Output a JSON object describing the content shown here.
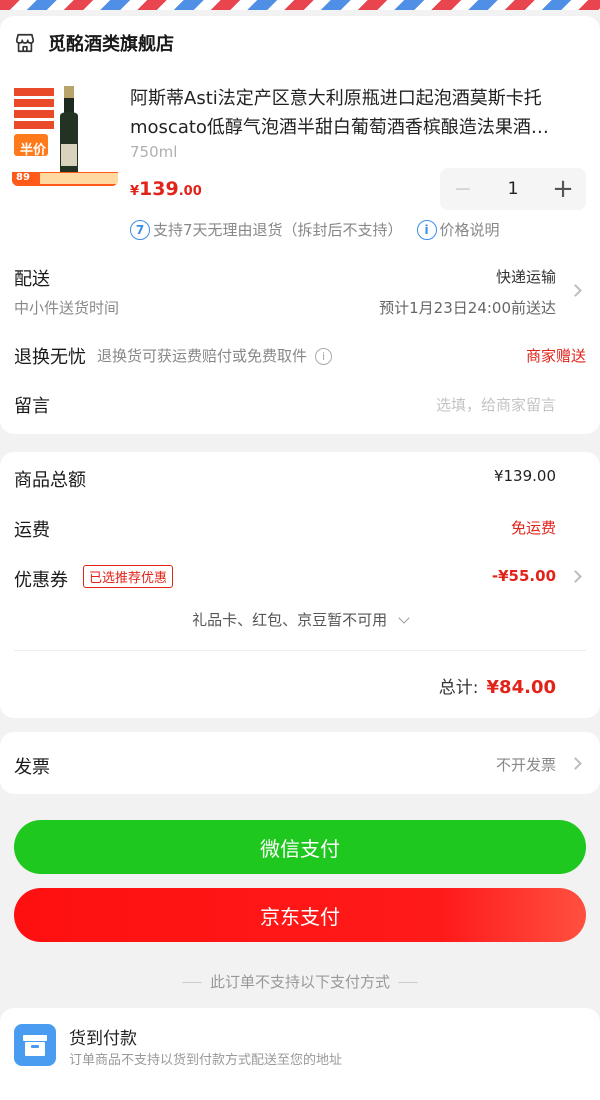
{
  "store": {
    "name": "觅酩酒类旗舰店"
  },
  "product": {
    "title": "阿斯蒂Asti法定产区意大利原瓶进口起泡酒莫斯卡托moscato低醇气泡酒半甜白葡萄酒香槟酿造法果酒…",
    "volume": "750ml",
    "price_currency": "¥",
    "price_int": "139",
    "price_dec": ".00",
    "quantity": "1",
    "image_badge": "半价",
    "image_price": "89"
  },
  "policy": {
    "badge": "7",
    "return_text": "支持7天无理由退货（拆封后不支持）",
    "price_note": "价格说明"
  },
  "delivery": {
    "label": "配送",
    "method": "快递运输",
    "sub": "中小件送货时间",
    "eta": "预计1月23日24:00前送达"
  },
  "worry_free": {
    "label": "退换无忧",
    "desc": "退换货可获运费赔付或免费取件",
    "status": "商家赠送"
  },
  "message": {
    "label": "留言",
    "placeholder": "选填，给商家留言"
  },
  "summary": {
    "goods_label": "商品总额",
    "goods_value": "¥139.00",
    "shipping_label": "运费",
    "shipping_value": "免运费",
    "coupon_label": "优惠券",
    "coupon_tag": "已选推荐优惠",
    "coupon_value": "-¥55.00",
    "unavailable": "礼品卡、红包、京豆暂不可用",
    "total_label": "总计:",
    "total_value": "¥84.00"
  },
  "invoice": {
    "label": "发票",
    "value": "不开发票"
  },
  "payment": {
    "wechat": "微信支付",
    "jd": "京东支付",
    "unsupported_note": "此订单不支持以下支付方式"
  },
  "cod": {
    "title": "货到付款",
    "desc": "订单商品不支持以货到付款方式配送至您的地址"
  },
  "colors": {
    "accent": "#e2231a",
    "wechat_green": "#1ec81e",
    "jd_red": "#ff1a1a",
    "info_blue": "#3b8ee8"
  }
}
